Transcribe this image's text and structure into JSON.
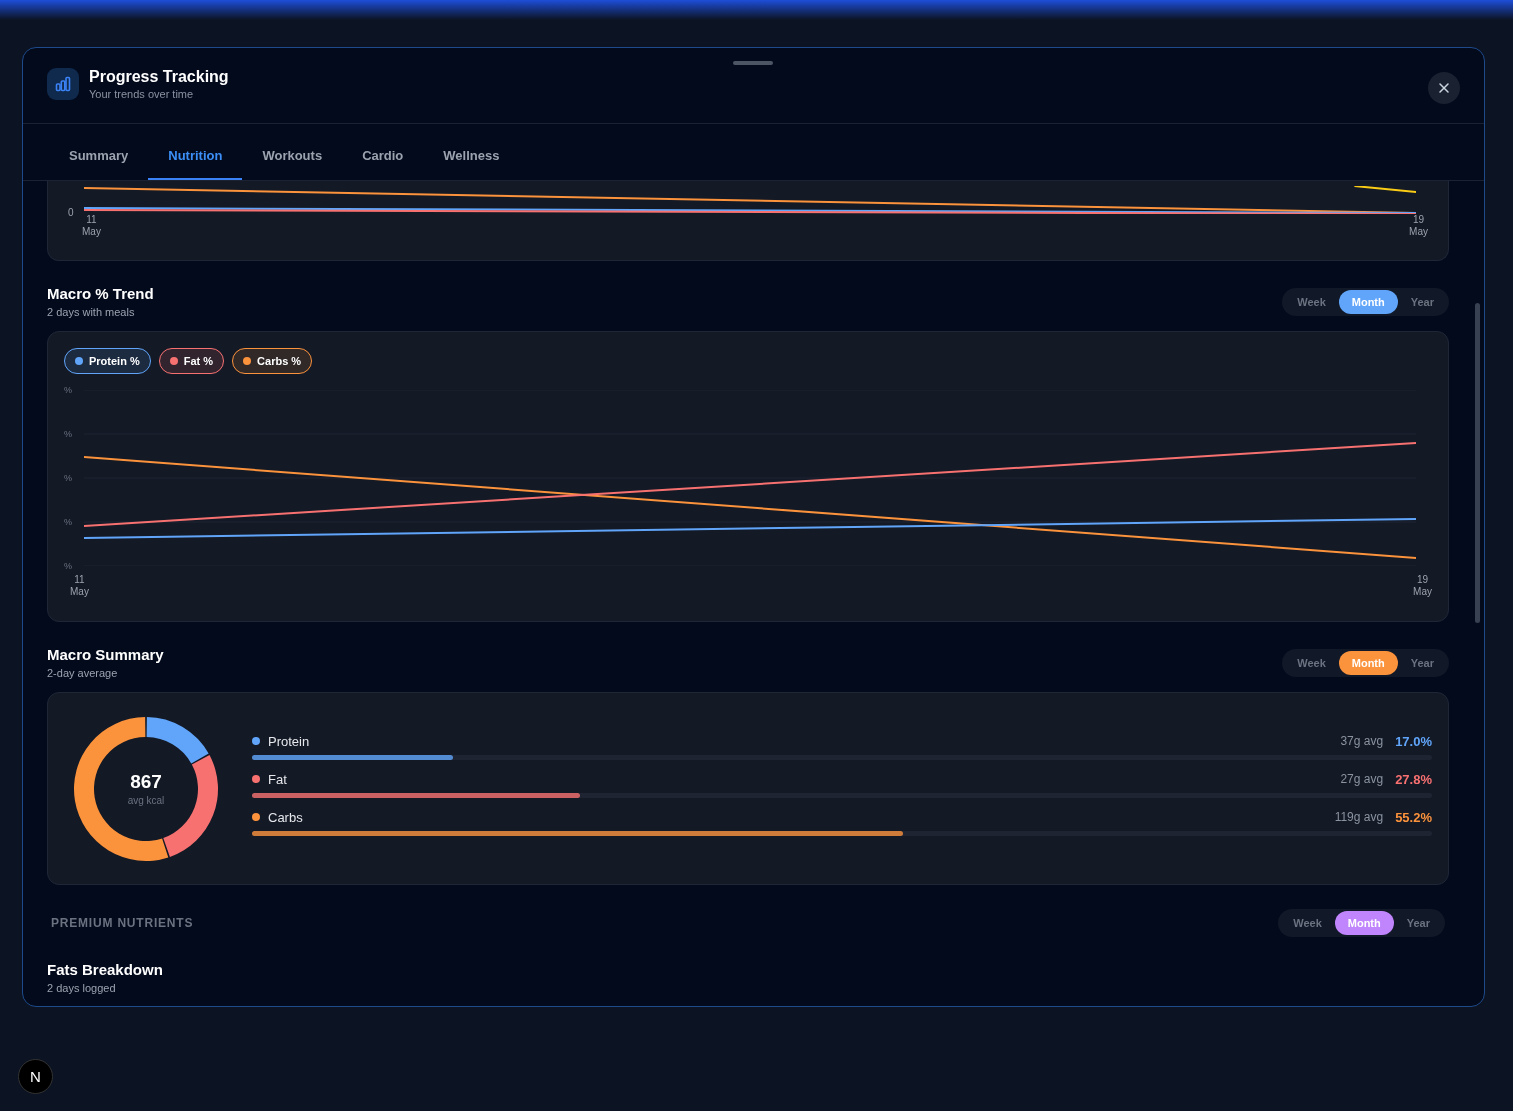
{
  "window": {
    "title": "Progress Tracking",
    "subtitle": "Your trends over time"
  },
  "tabs": [
    {
      "label": "Summary",
      "selected": false
    },
    {
      "label": "Nutrition",
      "selected": true
    },
    {
      "label": "Workouts",
      "selected": false
    },
    {
      "label": "Cardio",
      "selected": false
    },
    {
      "label": "Wellness",
      "selected": false
    }
  ],
  "top_chart": {
    "y_tick": "0",
    "x_labels": [
      {
        "day": "11",
        "month": "May"
      },
      {
        "day": "19",
        "month": "May"
      }
    ]
  },
  "macro_trend": {
    "title": "Macro % Trend",
    "subtitle": "2 days with meals",
    "period": {
      "color": "#60a5fa",
      "options": [
        {
          "label": "Week",
          "selected": false
        },
        {
          "label": "Month",
          "selected": true
        },
        {
          "label": "Year",
          "selected": false
        }
      ]
    },
    "legend": [
      {
        "label": "Protein %",
        "color": "#60a5fa"
      },
      {
        "label": "Fat %",
        "color": "#f87171"
      },
      {
        "label": "Carbs %",
        "color": "#fb923c"
      }
    ],
    "y_ticks": [
      "%",
      "%",
      "%",
      "%",
      "%"
    ],
    "x_labels": [
      {
        "day": "11",
        "month": "May"
      },
      {
        "day": "19",
        "month": "May"
      }
    ]
  },
  "macro_summary": {
    "title": "Macro Summary",
    "subtitle": "2-day average",
    "period": {
      "color": "#fb923c",
      "options": [
        {
          "label": "Week",
          "selected": false
        },
        {
          "label": "Month",
          "selected": true
        },
        {
          "label": "Year",
          "selected": false
        }
      ]
    },
    "donut": {
      "value": "867",
      "caption": "avg kcal"
    },
    "macros": [
      {
        "name": "Protein",
        "color": "#60a5fa",
        "level": 0.17,
        "grams": "37g avg",
        "percent": "17.0%"
      },
      {
        "name": "Fat",
        "color": "#f87171",
        "level": 0.278,
        "grams": "27g avg",
        "percent": "27.8%"
      },
      {
        "name": "Carbs",
        "color": "#fb923c",
        "level": 0.552,
        "grams": "119g avg",
        "percent": "55.2%"
      }
    ]
  },
  "premium": {
    "label": "PREMIUM NUTRIENTS",
    "title": "Fats Breakdown",
    "subtitle": "2 days logged",
    "period": {
      "color": "#c084fc",
      "options": [
        {
          "label": "Week",
          "selected": false
        },
        {
          "label": "Month",
          "selected": true
        },
        {
          "label": "Year",
          "selected": false
        }
      ]
    }
  },
  "dev_badge": "N"
}
